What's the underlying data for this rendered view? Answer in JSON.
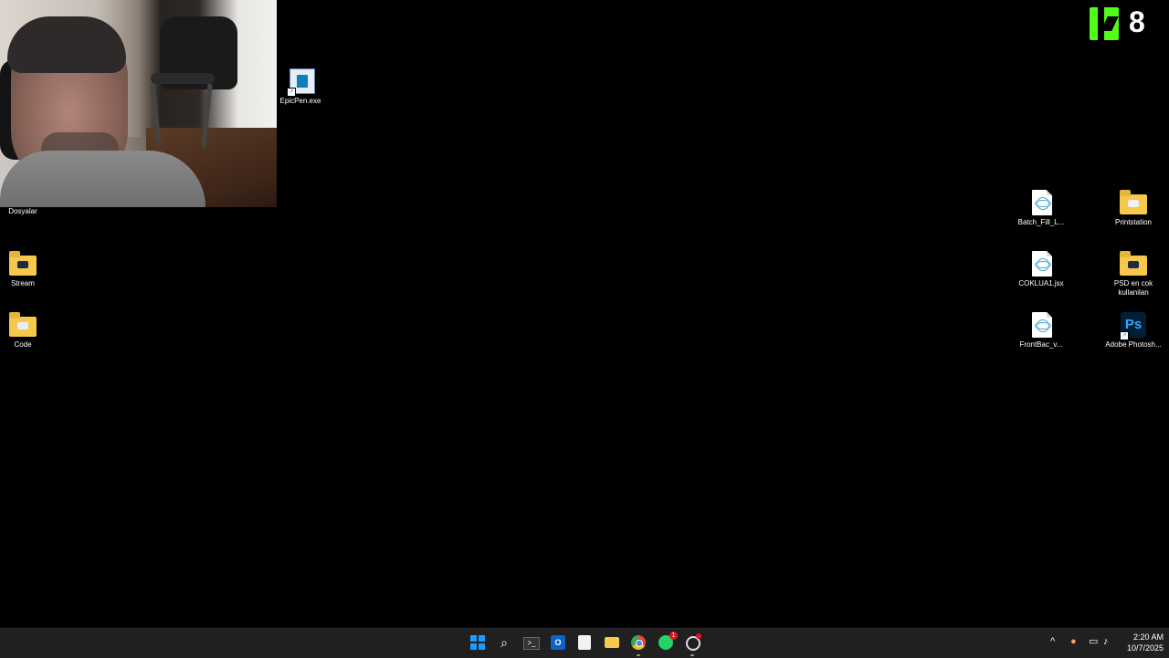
{
  "desktop": {
    "icons": [
      {
        "label": "EpicPen.exe"
      },
      {
        "label": "Dosyalar"
      },
      {
        "label": "Stream"
      },
      {
        "label": "Code"
      },
      {
        "label": "Batch_Fill_L..."
      },
      {
        "label": "Printstation"
      },
      {
        "label": "COKLUA1.jsx"
      },
      {
        "label": "PSD en cok kullanilan"
      },
      {
        "label": "FrontBac_v..."
      },
      {
        "label": "Adobe Photosh..."
      }
    ],
    "overlay": {
      "logo_letter": "K",
      "count": "8",
      "logo_color": "#53fc18"
    }
  },
  "taskbar": {
    "items": [
      {
        "name": "start",
        "icon": "windows-icon"
      },
      {
        "name": "search",
        "icon": "search-icon"
      },
      {
        "name": "terminal",
        "icon": "terminal-icon"
      },
      {
        "name": "outlook",
        "icon": "outlook-icon"
      },
      {
        "name": "snipping",
        "icon": "snipping-icon"
      },
      {
        "name": "file-explorer",
        "icon": "folder-icon"
      },
      {
        "name": "chrome",
        "icon": "chrome-icon"
      },
      {
        "name": "whatsapp",
        "icon": "whatsapp-icon",
        "badge": "1"
      },
      {
        "name": "app",
        "icon": "app-icon"
      }
    ],
    "tray": {
      "chevron": "^",
      "time": "2:20 AM",
      "date": "10/7/2025"
    }
  }
}
